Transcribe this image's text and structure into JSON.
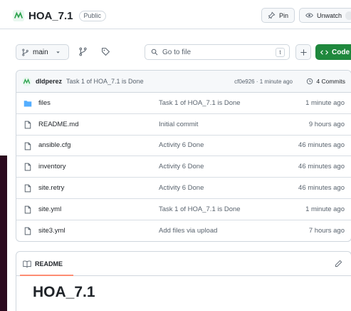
{
  "repo": {
    "name": "HOA_7.1",
    "visibility": "Public",
    "pin_label": "Pin",
    "watch_label": "Unwatch"
  },
  "toolbar": {
    "branch": "main",
    "search_placeholder": "Go to file",
    "shortcut_key": "t",
    "code_label": "Code"
  },
  "last_commit": {
    "author": "dldperez",
    "message": "Task 1 of HOA_7.1 is Done",
    "meta": "cf0e926 · 1 minute ago",
    "commits_label": "4 Commits"
  },
  "files": [
    {
      "name": "files",
      "type": "folder",
      "commit": "Task 1 of HOA_7.1 is Done",
      "age": "1 minute ago"
    },
    {
      "name": "README.md",
      "type": "file",
      "commit": "Initial commit",
      "age": "9 hours ago"
    },
    {
      "name": "ansible.cfg",
      "type": "file",
      "commit": "Activity 6 Done",
      "age": "46 minutes ago"
    },
    {
      "name": "inventory",
      "type": "file",
      "commit": "Activity 6 Done",
      "age": "46 minutes ago"
    },
    {
      "name": "site.retry",
      "type": "file",
      "commit": "Activity 6 Done",
      "age": "46 minutes ago"
    },
    {
      "name": "site.yml",
      "type": "file",
      "commit": "Task 1 of HOA_7.1 is Done",
      "age": "1 minute ago"
    },
    {
      "name": "site3.yml",
      "type": "file",
      "commit": "Add files via upload",
      "age": "7 hours ago"
    }
  ],
  "readme": {
    "tab_label": "README",
    "heading": "HOA_7.1"
  },
  "colors": {
    "code_button": "#1f883d",
    "folder_icon": "#54aeff",
    "tab_underline": "#fd8c73"
  }
}
